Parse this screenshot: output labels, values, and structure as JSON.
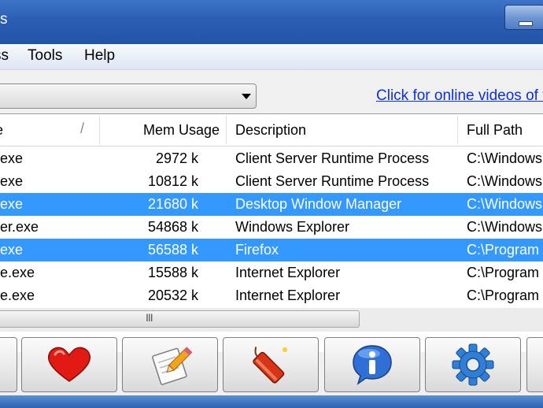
{
  "window": {
    "title_fragment": "s"
  },
  "menu": {
    "items": [
      "ss",
      "Tools",
      "Help"
    ]
  },
  "combo": {
    "value": ""
  },
  "link": {
    "text": "Click for online videos of th"
  },
  "table": {
    "columns": [
      "e",
      "Mem Usage",
      "Description",
      "Full Path"
    ],
    "rows": [
      {
        "name": "exe",
        "mem": "2972 k",
        "desc": "Client Server Runtime Process",
        "path": "C:\\Windows",
        "selected": false
      },
      {
        "name": "exe",
        "mem": "10812 k",
        "desc": "Client Server Runtime Process",
        "path": "C:\\Windows",
        "selected": false
      },
      {
        "name": "exe",
        "mem": "21680 k",
        "desc": "Desktop Window Manager",
        "path": "C:\\Windows",
        "selected": true
      },
      {
        "name": "er.exe",
        "mem": "54868 k",
        "desc": "Windows Explorer",
        "path": "C:\\Windows",
        "selected": false
      },
      {
        "name": "exe",
        "mem": "56588 k",
        "desc": "Firefox",
        "path": "C:\\Program",
        "selected": true
      },
      {
        "name": "e.exe",
        "mem": "15588 k",
        "desc": "Internet Explorer",
        "path": "C:\\Program",
        "selected": false
      },
      {
        "name": "e.exe",
        "mem": "20532 k",
        "desc": "Internet Explorer",
        "path": "C:\\Program",
        "selected": false
      }
    ]
  },
  "scrollbar": {
    "grip": "III"
  },
  "toolbar": {
    "buttons": [
      "partial-button",
      "heart-icon",
      "notepad-pencil-icon",
      "dynamite-icon",
      "info-icon",
      "gear-icon",
      "partial-button"
    ]
  },
  "colors": {
    "selection": "#3399ff",
    "link": "#0a2ee6",
    "titlebar": "#2a5eb3"
  }
}
